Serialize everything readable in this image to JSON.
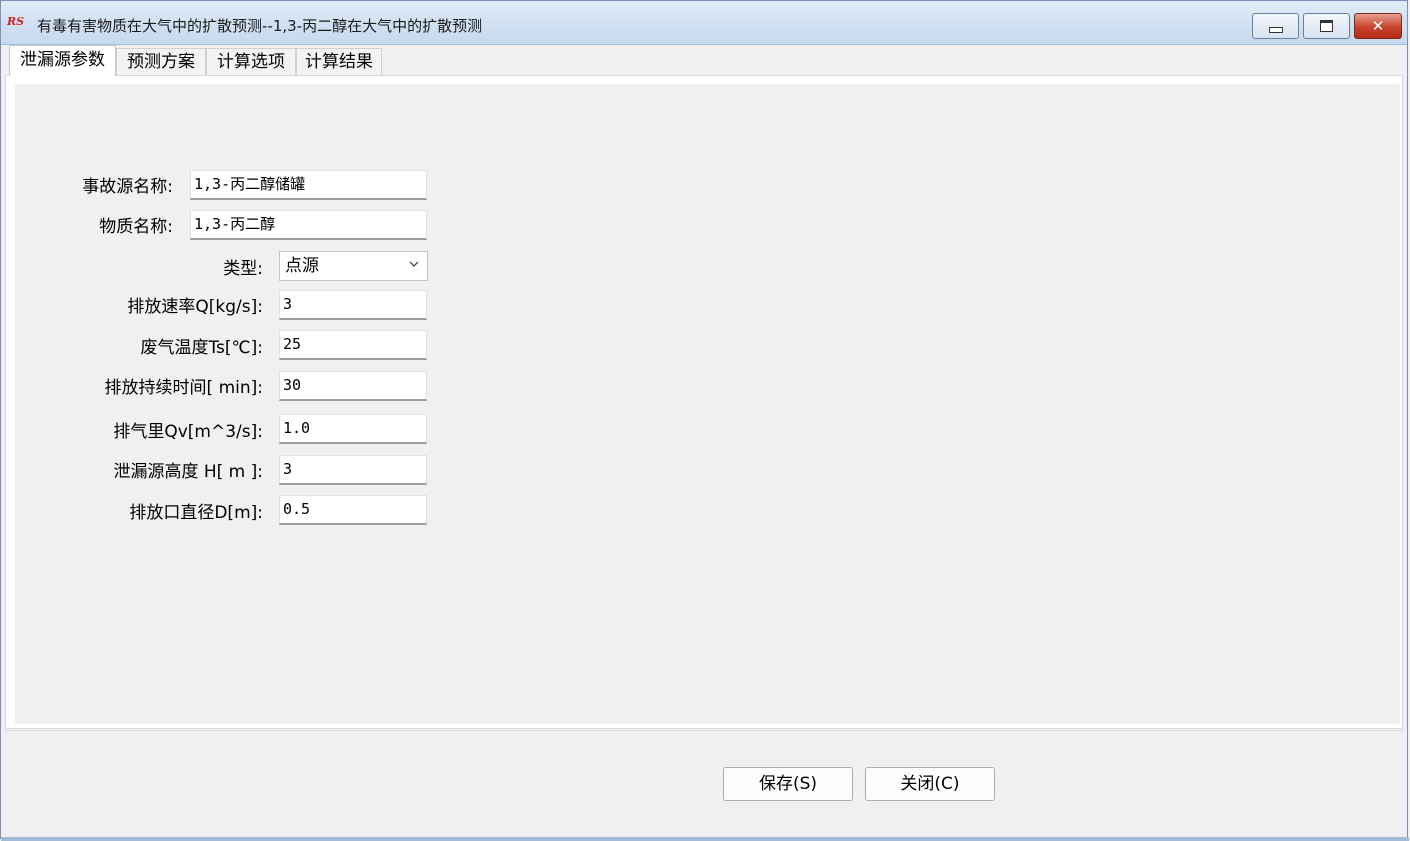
{
  "window": {
    "icon_text": "RS",
    "title": "有毒有害物质在大气中的扩散预测--1,3-丙二醇在大气中的扩散预测",
    "icons": {
      "minimize": "minimize-icon",
      "maximize": "maximize-icon",
      "close": "close-icon"
    },
    "close_color": "#c8432c"
  },
  "tabs": [
    {
      "label": "泄漏源参数",
      "active": true
    },
    {
      "label": "预测方案",
      "active": false
    },
    {
      "label": "计算选项",
      "active": false
    },
    {
      "label": "计算结果",
      "active": false
    }
  ],
  "form": {
    "source_name": {
      "label": "事故源名称:",
      "value": "1,3-丙二醇储罐"
    },
    "substance_name": {
      "label": "物质名称:",
      "value": "1,3-丙二醇"
    },
    "type": {
      "label": "类型:",
      "value": "点源"
    },
    "emission_rate": {
      "label": "排放速率Q[kg/s]:",
      "value": "3"
    },
    "gas_temp": {
      "label": "废气温度Ts[℃]:",
      "value": "25"
    },
    "duration": {
      "label": "排放持续时间[ min]:",
      "value": "30"
    },
    "exhaust_volume": {
      "label": "排气里Qv[m^3/s]:",
      "value": "1.0"
    },
    "source_height": {
      "label": "泄漏源高度 H[  m ]:",
      "value": "3"
    },
    "outlet_diameter": {
      "label": "排放口直径D[m]:",
      "value": "0.5"
    }
  },
  "buttons": {
    "save": "保存(S)",
    "close": "关闭(C)"
  }
}
